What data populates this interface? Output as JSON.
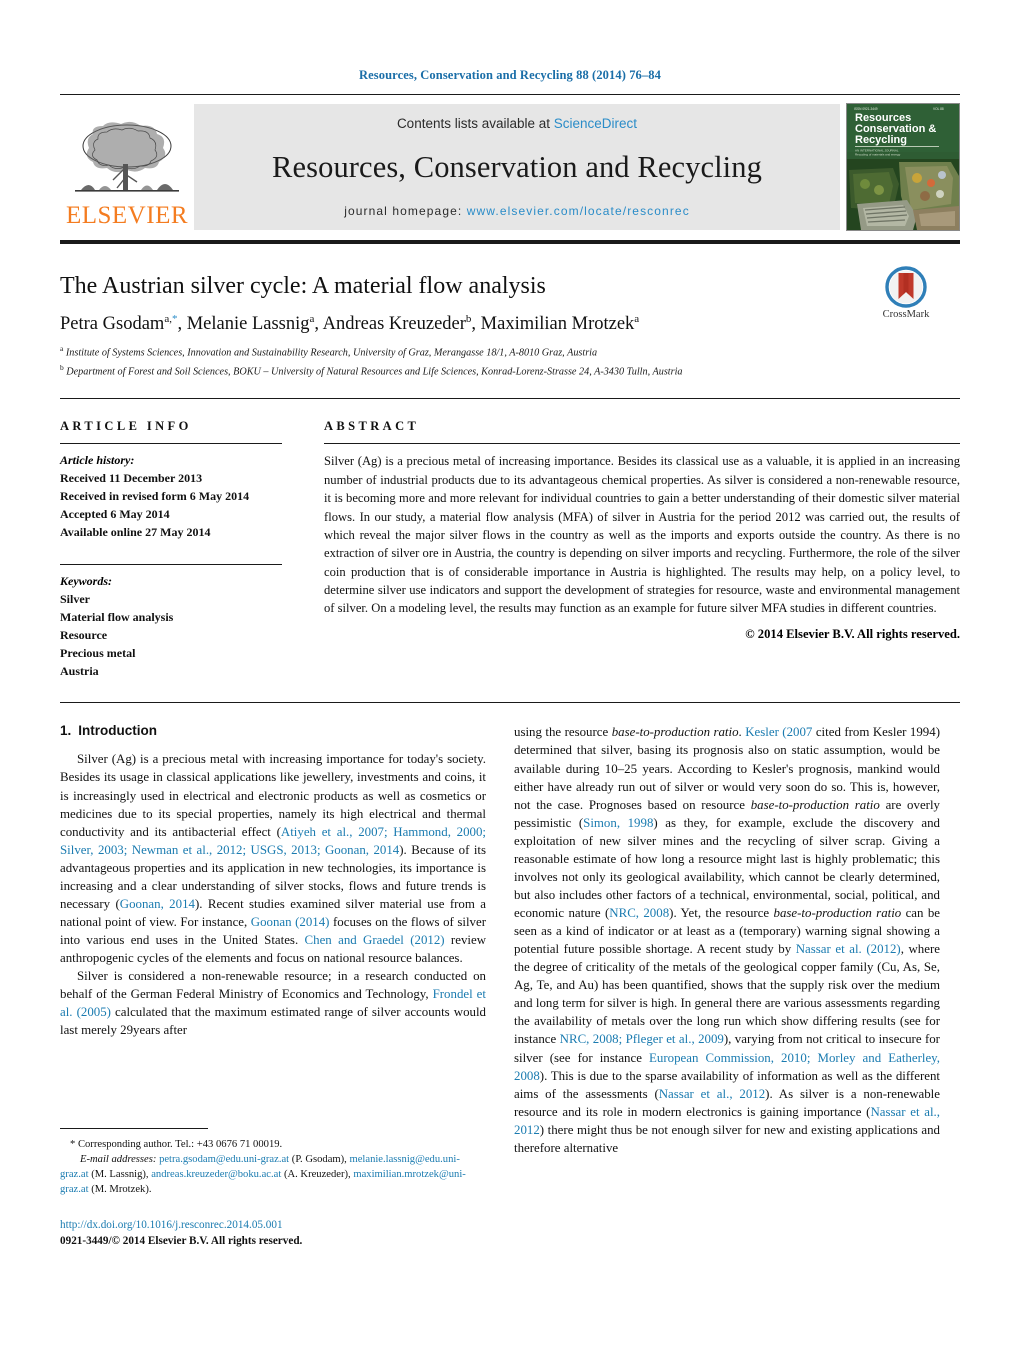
{
  "running_head": "Resources, Conservation and Recycling 88 (2014) 76–84",
  "masthead": {
    "contents_prefix": "Contents lists available at ",
    "contents_link": "ScienceDirect",
    "journal_title": "Resources, Conservation and Recycling",
    "homepage_prefix": "journal homepage:",
    "homepage_url": "www.elsevier.com/locate/resconrec",
    "publisher": "ELSEVIER",
    "cover_title_line1": "Resources",
    "cover_title_line2": "Conservation &",
    "cover_title_line3": "Recycling"
  },
  "article": {
    "title": "The Austrian silver cycle: A material flow analysis",
    "authors": [
      {
        "name": "Petra Gsodam",
        "marks": "a,",
        "star": "*"
      },
      {
        "name": "Melanie Lassnig",
        "marks": "a",
        "star": ""
      },
      {
        "name": "Andreas Kreuzeder",
        "marks": "b",
        "star": ""
      },
      {
        "name": "Maximilian Mrotzek",
        "marks": "a",
        "star": ""
      }
    ],
    "affiliations": [
      {
        "mark": "a",
        "text": "Institute of Systems Sciences, Innovation and Sustainability Research, University of Graz, Merangasse 18/1, A-8010 Graz, Austria"
      },
      {
        "mark": "b",
        "text": "Department of Forest and Soil Sciences, BOKU – University of Natural Resources and Life Sciences, Konrad-Lorenz-Strasse 24, A-3430 Tulln, Austria"
      }
    ],
    "crossmark_label": "CrossMark"
  },
  "article_info": {
    "heading": "ARTICLE INFO",
    "history_label": "Article history:",
    "history": [
      "Received 11 December 2013",
      "Received in revised form 6 May 2014",
      "Accepted 6 May 2014",
      "Available online 27 May 2014"
    ],
    "keywords_label": "Keywords:",
    "keywords": [
      "Silver",
      "Material flow analysis",
      "Resource",
      "Precious metal",
      "Austria"
    ]
  },
  "abstract": {
    "heading": "ABSTRACT",
    "text": "Silver (Ag) is a precious metal of increasing importance. Besides its classical use as a valuable, it is applied in an increasing number of industrial products due to its advantageous chemical properties. As silver is considered a non-renewable resource, it is becoming more and more relevant for individual countries to gain a better understanding of their domestic silver material flows. In our study, a material flow analysis (MFA) of silver in Austria for the period 2012 was carried out, the results of which reveal the major silver flows in the country as well as the imports and exports outside the country. As there is no extraction of silver ore in Austria, the country is depending on silver imports and recycling. Furthermore, the role of the silver coin production that is of considerable importance in Austria is highlighted. The results may help, on a policy level, to determine silver use indicators and support the development of strategies for resource, waste and environmental management of silver. On a modeling level, the results may function as an example for future silver MFA studies in different countries.",
    "copyright": "© 2014 Elsevier B.V. All rights reserved."
  },
  "introduction": {
    "number": "1.",
    "title": "Introduction"
  },
  "footnote": {
    "corresponding": "* Corresponding author. Tel.: +43 0676 71 00019.",
    "email_label": "E-mail addresses:",
    "email1": "petra.gsodam@edu.uni-graz.at",
    "email1_owner": "(P. Gsodam),",
    "email2": "melanie.lassnig@edu.uni-graz.at",
    "email2_owner": "(M. Lassnig),",
    "email3": "andreas.kreuzeder@boku.ac.at",
    "email3_owner": "(A. Kreuzeder),",
    "email4": "maximilian.mrotzek@uni-graz.at",
    "email4_owner": "(M. Mrotzek)."
  },
  "imprint": {
    "doi": "http://dx.doi.org/10.1016/j.resconrec.2014.05.001",
    "issn": "0921-3449/© 2014 Elsevier B.V. All rights reserved."
  },
  "colors": {
    "link": "#1a7bb0",
    "elsevier_orange": "#F47C20",
    "masthead_bg": "#e6e6e6",
    "cover_green": "#2f5d35"
  }
}
